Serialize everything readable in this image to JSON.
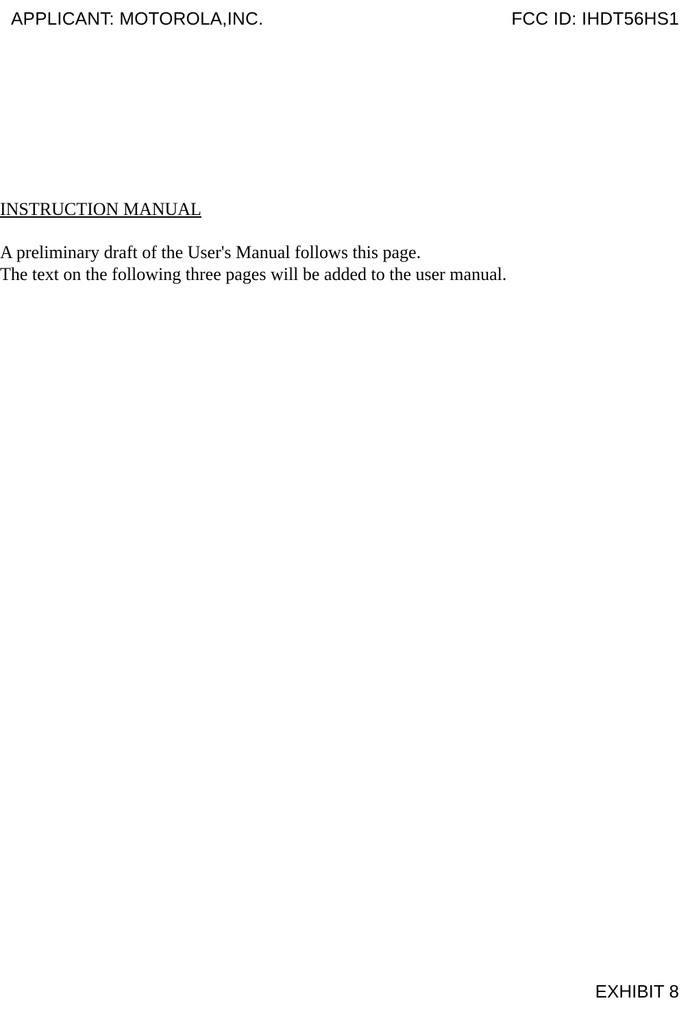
{
  "header": {
    "applicant_label": "APPLICANT: MOTOROLA,INC.",
    "fcc_id_label": "FCC ID: IHDT56HS1"
  },
  "content": {
    "section_title": "INSTRUCTION MANUAL",
    "line1": "A preliminary draft of the User's Manual follows this page.",
    "line2": "The text on the following three pages will be added to the user manual."
  },
  "footer": {
    "exhibit_label": "EXHIBIT 8"
  }
}
